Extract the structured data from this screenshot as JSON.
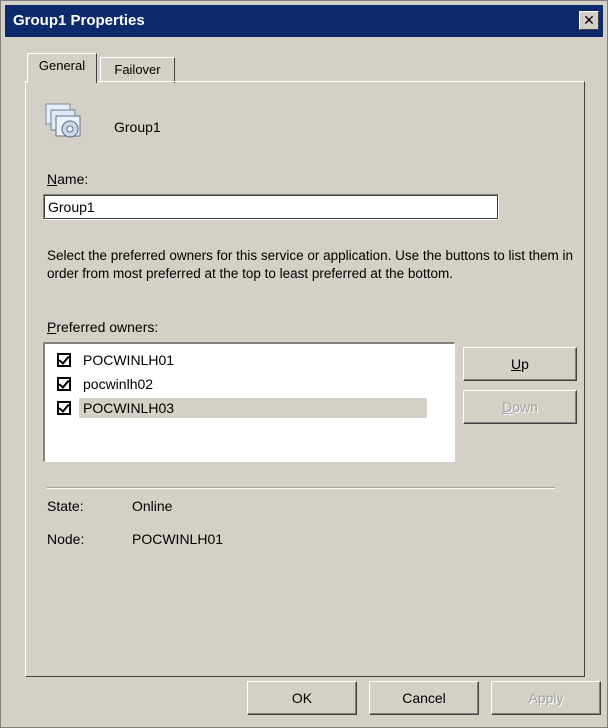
{
  "window": {
    "title": "Group1 Properties",
    "close_glyph": "✕"
  },
  "tabs": [
    {
      "label": "General",
      "active": true
    },
    {
      "label": "Failover",
      "active": false
    }
  ],
  "group": {
    "icon": "group-icon",
    "name": "Group1"
  },
  "name_field": {
    "label_underline": "N",
    "label_rest": "ame:",
    "value": "Group1"
  },
  "instruction": "Select the preferred owners for this service or application. Use the buttons to list them in order from most preferred at the top to least preferred at the bottom.",
  "owners": {
    "label_underline": "P",
    "label_rest": "referred owners:",
    "items": [
      {
        "name": "POCWINLH01",
        "checked": true,
        "selected": false
      },
      {
        "name": "pocwinlh02",
        "checked": true,
        "selected": false
      },
      {
        "name": "POCWINLH03",
        "checked": true,
        "selected": true
      }
    ]
  },
  "buttons": {
    "up_underline": "U",
    "up_rest": "p",
    "down_underline": "D",
    "down_rest": "own",
    "ok": "OK",
    "cancel": "Cancel",
    "apply": "Apply"
  },
  "info": {
    "state_label": "State:",
    "state_value": "Online",
    "node_label": "Node:",
    "node_value": "POCWINLH01"
  },
  "colors": {
    "titlebar": "#0c2a6c",
    "face": "#d4d0c8",
    "disabled_text": "#a0a0a0"
  }
}
